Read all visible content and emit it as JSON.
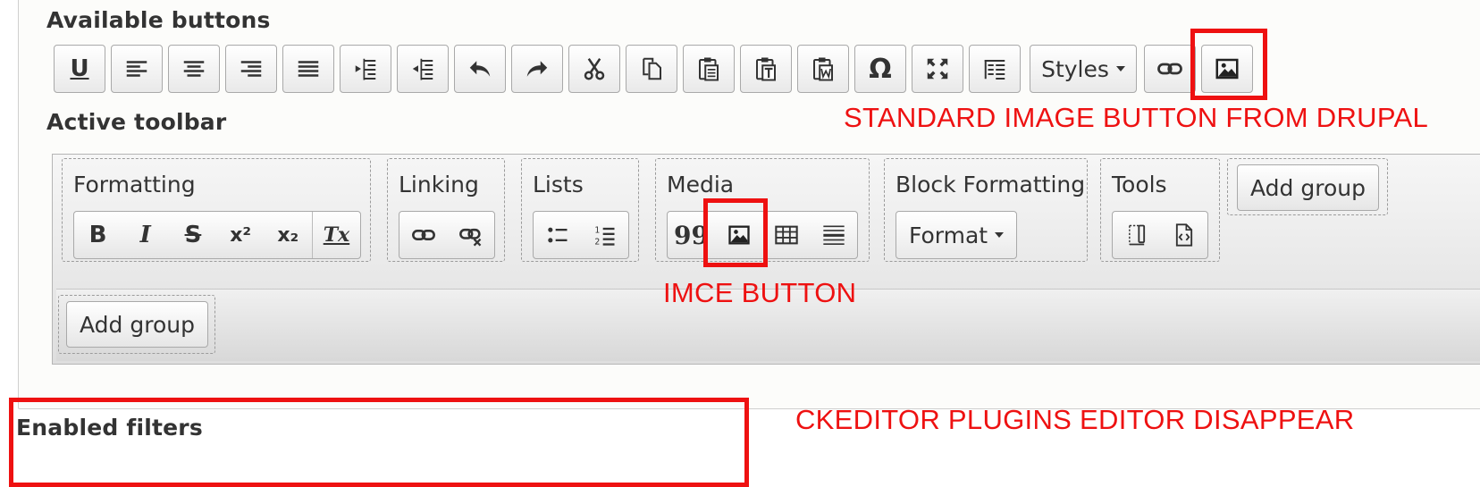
{
  "available": {
    "heading": "Available buttons",
    "styles_label": "Styles",
    "buttons": [
      {
        "icon": "underline-icon",
        "glyph": "U"
      },
      {
        "icon": "align-left-icon"
      },
      {
        "icon": "align-center-icon"
      },
      {
        "icon": "align-right-icon"
      },
      {
        "icon": "align-justify-icon"
      },
      {
        "icon": "outdent-icon"
      },
      {
        "icon": "indent-icon"
      },
      {
        "icon": "undo-icon"
      },
      {
        "icon": "redo-icon"
      },
      {
        "icon": "cut-icon"
      },
      {
        "icon": "copy-icon"
      },
      {
        "icon": "paste-icon"
      },
      {
        "icon": "paste-text-icon"
      },
      {
        "icon": "paste-word-icon"
      },
      {
        "icon": "special-char-icon",
        "glyph": "Ω"
      },
      {
        "icon": "maximize-icon"
      },
      {
        "icon": "show-blocks-icon"
      },
      {
        "icon": "link-icon"
      },
      {
        "icon": "image-icon"
      }
    ]
  },
  "active": {
    "heading": "Active toolbar",
    "groups": {
      "formatting": "Formatting",
      "linking": "Linking",
      "lists": "Lists",
      "media": "Media",
      "block_formatting": "Block Formatting",
      "tools": "Tools"
    },
    "format_label": "Format",
    "add_group_label": "Add group",
    "bold_glyph": "B",
    "italic_glyph": "I",
    "strike_glyph": "S",
    "superscript_glyph": "x²",
    "subscript_glyph": "x₂",
    "remove_format_glyph": "Tx",
    "blockquote_glyph": "99"
  },
  "annotations": {
    "standard_image": "STANDARD IMAGE BUTTON FROM DRUPAL",
    "imce": "IMCE BUTTON",
    "plugins": "CKEDITOR PLUGINS EDITOR DISAPPEAR"
  },
  "filters": {
    "heading": "Enabled filters"
  },
  "colors": {
    "annotation_red": "#ee1111"
  }
}
